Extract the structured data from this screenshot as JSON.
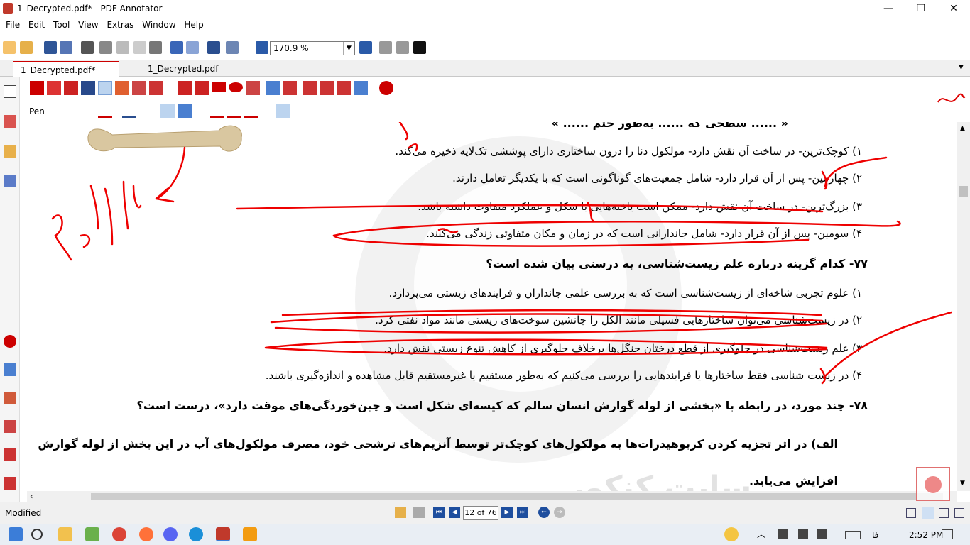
{
  "window": {
    "title": "1_Decrypted.pdf* - PDF Annotator",
    "minimize": "—",
    "maximize": "❐",
    "close": "✕"
  },
  "menu": [
    "File",
    "Edit",
    "Tool",
    "View",
    "Extras",
    "Window",
    "Help"
  ],
  "toolbar": {
    "zoom_value": "170.9 %"
  },
  "tabs": [
    {
      "label": "1_Decrypted.pdf*",
      "active": true
    },
    {
      "label": "1_Decrypted.pdf",
      "active": false
    }
  ],
  "palette": {
    "tool_label": "Pen"
  },
  "document": {
    "lines": [
      {
        "text": "« ...... سطحی که ...... به‌طور حتم ...... »",
        "kind": "line"
      },
      {
        "text": "۱) کوچک‌ترین- در ساخت آن نقش دارد- مولکول دنا را درون ساختاری دارای پوششی تک‌لایه ذخیره می‌کند.",
        "kind": "line"
      },
      {
        "text": "۲) چهارمین- پس از آن قرار دارد- شامل جمعیت‌های گوناگونی است که با یکدیگر تعامل دارند.",
        "kind": "line"
      },
      {
        "text": "۳) بزرگ‌ترین- در ساخت آن نقش دارد- ممکن است یاخته‌هایی با شکل و عملکرد متفاوت داشته باشد.",
        "kind": "line"
      },
      {
        "text": "۴) سومین- پس از آن قرار دارد- شامل جاندارانی است که در زمان و مکان متفاوتی زندگی می‌کنند.",
        "kind": "line"
      },
      {
        "text": "۷۷- کدام گزینه درباره علم زیست‌شناسی، به درستی بیان شده است؟",
        "kind": "q"
      },
      {
        "text": "۱) علوم تجربی شاخه‌ای از زیست‌شناسی است که به بررسی علمی جانداران و فرایندهای زیستی می‌پردازد.",
        "kind": "line"
      },
      {
        "text": "۲) در زیست‌شناسی می‌توان ساختارهایی فسیلی مانند الکل را جانشین سوخت‌های زیستی مانند مواد نفتی کرد.",
        "kind": "line"
      },
      {
        "text": "۳) علم زیست‌شناسی در جلوگیری از قطع درختان جنگل‌ها برخلاف جلوگیری از کاهش تنوع زیستی نقش دارد.",
        "kind": "line"
      },
      {
        "text": "۴) در زیست شناسی فقط ساختارها یا فرایندهایی را بررسی می‌کنیم که به‌طور مستقیم یا غیرمستقیم قابل مشاهده و اندازه‌گیری باشند.",
        "kind": "line"
      },
      {
        "text": "۷۸- چند مورد، در رابطه با «بخشی از لوله گوارش انسان سالم که کیسه‌ای شکل است و چین‌خوردگی‌های موقت دارد»، درست است؟",
        "kind": "q"
      },
      {
        "text": "الف) در اثر تجزیه کردن کربوهیدرات‌ها به مولکول‌های کوچک‌تر توسط آنزیم‌های ترشحی خود، مصرف مولکول‌های آب در این بخش از لوله گوارش",
        "kind": "q"
      },
      {
        "text": "افزایش می‌یابد.",
        "kind": "q"
      }
    ],
    "watermark": "سایت کنکور"
  },
  "status": {
    "left": "Modified",
    "page": "12 of 76"
  },
  "taskbar": {
    "lang": "فا",
    "time": "2:52 PM"
  },
  "colors": {
    "accent": "#cc0000",
    "nav_blue": "#1e4e9e"
  }
}
